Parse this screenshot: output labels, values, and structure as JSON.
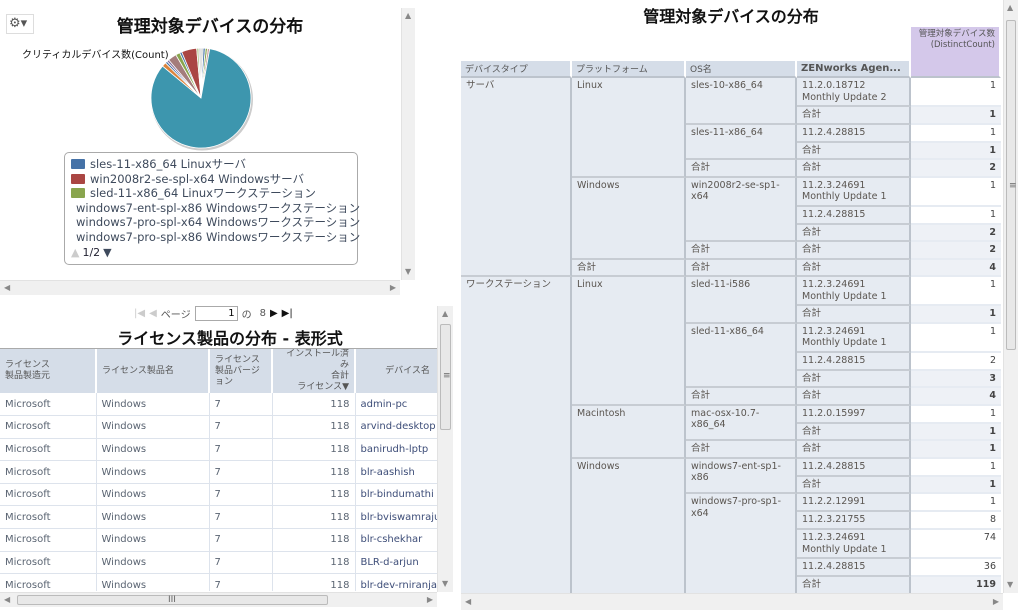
{
  "pie_panel": {
    "title": "管理対象デバイスの分布",
    "subtitle": "クリティカルデバイス数(Count)",
    "gear_icon": "gear-dropdown-icon",
    "legend": [
      {
        "label": "sles-11-x86_64 Linuxサーバ",
        "color": "#4572a7"
      },
      {
        "label": "win2008r2-se-spl-x64 Windowsサーバ",
        "color": "#aa4643"
      },
      {
        "label": "sled-11-x86_64 Linuxワークステーション",
        "color": "#89a54e"
      },
      {
        "label": "windows7-ent-spl-x86 Windowsワークステーション",
        "color": "#80699b"
      },
      {
        "label": "windows7-pro-spl-x64 Windowsワークステーション",
        "color": "#3d96ae"
      },
      {
        "label": "windows7-pro-spl-x86 Windowsワークステーション",
        "color": "#db843d"
      }
    ],
    "legend_page": "1/2"
  },
  "chart_data": {
    "type": "pie",
    "title": "管理対象デバイスの分布",
    "subtitle": "クリティカルデバイス数(Count)",
    "slices": [
      {
        "value": 1,
        "color": "#c8c8c8"
      },
      {
        "name": "sles-11-x86_64 Linuxサーバ",
        "value": 1,
        "color": "#4572a7"
      },
      {
        "name": "sled-11-x86_64 Linuxワークステーション",
        "value": 1,
        "color": "#89a54e"
      },
      {
        "value": 1,
        "color": "#c8a0a0"
      },
      {
        "name": "windows7-pro-spl-x64 Windowsワークステーション",
        "value": 119,
        "color": "#3d96ae"
      },
      {
        "name": "windows7-pro-spl-x86 Windowsワークステーション",
        "value": 2,
        "color": "#db843d"
      },
      {
        "value": 1,
        "color": "#4572a7"
      },
      {
        "name": "windows7-ent-spl-x86 Windowsワークステーション",
        "value": 1,
        "color": "#80699b"
      },
      {
        "value": 4,
        "color": "#a47d7c"
      },
      {
        "value": 2,
        "color": "#89a54e"
      },
      {
        "value": 1,
        "color": "#4572a7"
      },
      {
        "name": "win2008r2-se-spl-x64 Windowsサーバ",
        "value": 7,
        "color": "#aa4643"
      },
      {
        "value": 1,
        "color": "#b5ca92"
      },
      {
        "value": 1,
        "color": "#d0d0d0"
      }
    ],
    "legend_placement": "bottom"
  },
  "license": {
    "pager": {
      "page_label": "ページ",
      "page_value": "1",
      "of_label": "の",
      "total_pages": "8"
    },
    "title": "ライセンス製品の分布 - 表形式",
    "columns": [
      "ライセンス\n製品製造元",
      "ライセンス製品名",
      "ライセンス\n製品バージョン",
      "インストール済み\n合計\nライセンス▼",
      "デバイス名"
    ],
    "rows": [
      [
        "Microsoft",
        "Windows",
        "7",
        "118",
        "admin-pc"
      ],
      [
        "Microsoft",
        "Windows",
        "7",
        "118",
        "arvind-desktop"
      ],
      [
        "Microsoft",
        "Windows",
        "7",
        "118",
        "banirudh-lptp"
      ],
      [
        "Microsoft",
        "Windows",
        "7",
        "118",
        "blr-aashish"
      ],
      [
        "Microsoft",
        "Windows",
        "7",
        "118",
        "blr-bindumathi"
      ],
      [
        "Microsoft",
        "Windows",
        "7",
        "118",
        "blr-bviswamraju"
      ],
      [
        "Microsoft",
        "Windows",
        "7",
        "118",
        "blr-cshekhar"
      ],
      [
        "Microsoft",
        "Windows",
        "7",
        "118",
        "BLR-d-arjun"
      ],
      [
        "Microsoft",
        "Windows",
        "7",
        "118",
        "blr-dev-rniranjan"
      ],
      [
        "",
        "",
        "",
        "",
        ""
      ]
    ]
  },
  "devices": {
    "title": "管理対象デバイスの分布",
    "measure_header": "管理対象デバイス数\n(DistinctCount)",
    "columns": [
      "デバイスタイプ",
      "プラットフォーム",
      "OS名",
      "ZENworks Agen..."
    ],
    "total_label": "合計",
    "types": [
      {
        "name": "サーバ",
        "platforms": [
          {
            "name": "Linux",
            "total": "2",
            "oses": [
              {
                "name": "sles-10-x86_64",
                "total": "1",
                "versions": [
                  {
                    "v": "11.2.0.18712\nMonthly Update 2",
                    "c": "1"
                  }
                ]
              },
              {
                "name": "sles-11-x86_64",
                "total": "1",
                "versions": [
                  {
                    "v": "11.2.4.28815",
                    "c": "1"
                  }
                ]
              }
            ]
          },
          {
            "name": "Windows",
            "total": "2",
            "oses": [
              {
                "name": "win2008r2-se-sp1-x64",
                "total": "2",
                "versions": [
                  {
                    "v": "11.2.3.24691\nMonthly Update 1",
                    "c": "1"
                  },
                  {
                    "v": "11.2.4.28815",
                    "c": "1"
                  }
                ]
              }
            ]
          }
        ],
        "total": "4"
      },
      {
        "name": "ワークステーション",
        "platforms": [
          {
            "name": "Linux",
            "total": "4",
            "oses": [
              {
                "name": "sled-11-i586",
                "total": "1",
                "versions": [
                  {
                    "v": "11.2.3.24691\nMonthly Update 1",
                    "c": "1"
                  }
                ]
              },
              {
                "name": "sled-11-x86_64",
                "total": "3",
                "versions": [
                  {
                    "v": "11.2.3.24691\nMonthly Update 1",
                    "c": "1"
                  },
                  {
                    "v": "11.2.4.28815",
                    "c": "2"
                  }
                ]
              }
            ]
          },
          {
            "name": "Macintosh",
            "total": "1",
            "oses": [
              {
                "name": "mac-osx-10.7-x86_64",
                "total": "1",
                "versions": [
                  {
                    "v": "11.2.0.15997",
                    "c": "1"
                  }
                ]
              }
            ]
          },
          {
            "name": "Windows",
            "oses": [
              {
                "name": "windows7-ent-sp1-x86",
                "total": "1",
                "versions": [
                  {
                    "v": "11.2.4.28815",
                    "c": "1"
                  }
                ]
              },
              {
                "name": "windows7-pro-sp1-x64",
                "total": "119",
                "versions": [
                  {
                    "v": "11.2.2.12991",
                    "c": "1"
                  },
                  {
                    "v": "11.2.3.21755",
                    "c": "8"
                  },
                  {
                    "v": "11.2.3.24691\nMonthly Update 1",
                    "c": "74"
                  },
                  {
                    "v": "11.2.4.28815",
                    "c": "36"
                  }
                ]
              }
            ]
          }
        ]
      }
    ]
  }
}
